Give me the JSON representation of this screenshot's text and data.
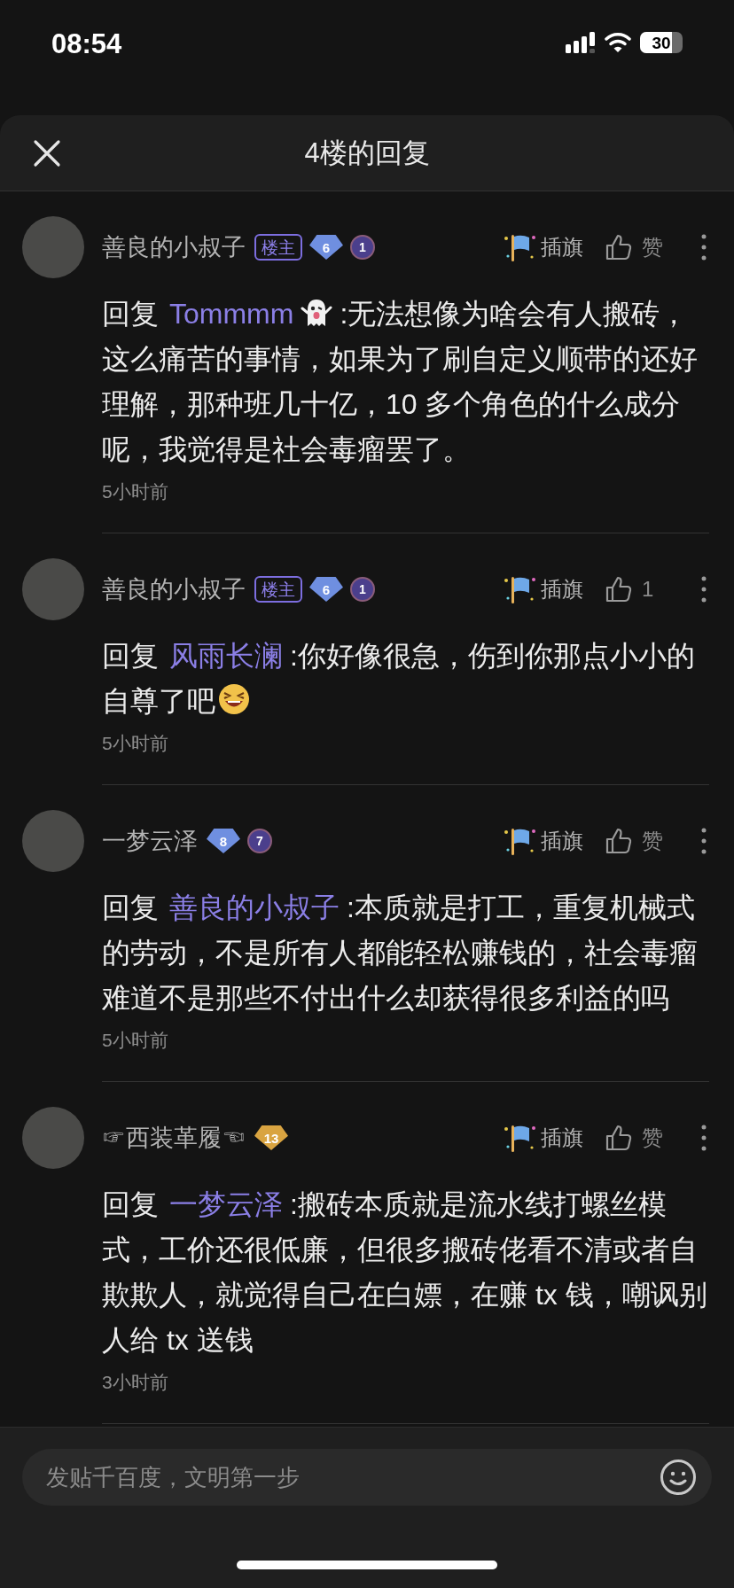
{
  "status_bar": {
    "time": "08:54",
    "battery": "30"
  },
  "sheet": {
    "title": "4楼的回复"
  },
  "comments": [
    {
      "author": "善良的小叔子",
      "badges": [
        {
          "kind": "host",
          "text": "楼主"
        },
        {
          "kind": "level",
          "text": "6",
          "color": "#6f8fe0"
        },
        {
          "kind": "medal",
          "text": "1"
        }
      ],
      "flag_label": "插旗",
      "like_label": "赞",
      "content": [
        {
          "kind": "prefix",
          "text": "回复"
        },
        {
          "kind": "mention",
          "text": "Tommmm"
        },
        {
          "kind": "ghost_emoji"
        },
        {
          "kind": "text",
          "text": ":无法想像为啥会有人搬砖，这么痛苦的事情，如果为了刷自定义顺带的还好理解，那种班几十亿，10 多个角色的什么成分呢，我觉得是社会毒瘤罢了。"
        }
      ],
      "time": "5小时前"
    },
    {
      "author": "善良的小叔子",
      "badges": [
        {
          "kind": "host",
          "text": "楼主"
        },
        {
          "kind": "level",
          "text": "6",
          "color": "#6f8fe0"
        },
        {
          "kind": "medal",
          "text": "1"
        }
      ],
      "flag_label": "插旗",
      "like_label": "1",
      "content": [
        {
          "kind": "prefix",
          "text": "回复"
        },
        {
          "kind": "mention",
          "text": "风雨长澜"
        },
        {
          "kind": "text",
          "text": ":你好像很急，伤到你那点小小的自尊了吧"
        },
        {
          "kind": "grin_emoji"
        }
      ],
      "time": "5小时前"
    },
    {
      "author": "一梦云泽",
      "badges": [
        {
          "kind": "level",
          "text": "8",
          "color": "#6f8fe0"
        },
        {
          "kind": "medal",
          "text": "7"
        }
      ],
      "flag_label": "插旗",
      "like_label": "赞",
      "content": [
        {
          "kind": "prefix",
          "text": "回复"
        },
        {
          "kind": "mention",
          "text": "善良的小叔子"
        },
        {
          "kind": "text",
          "text": ":本质就是打工，重复机械式的劳动，不是所有人都能轻松赚钱的，社会毒瘤难道不是那些不付出什么却获得很多利益的吗"
        }
      ],
      "time": "5小时前"
    },
    {
      "author": "☞西装革履☜",
      "badges": [
        {
          "kind": "level",
          "text": "13",
          "color": "#d9a441"
        }
      ],
      "flag_label": "插旗",
      "like_label": "赞",
      "content": [
        {
          "kind": "prefix",
          "text": "回复"
        },
        {
          "kind": "mention",
          "text": "一梦云泽"
        },
        {
          "kind": "text",
          "text": ":搬砖本质就是流水线打螺丝模式，工价还很低廉，但很多搬砖佬看不清或者自欺欺人，就觉得自己在白嫖，在赚 tx 钱，嘲讽别人给 tx 送钱"
        }
      ],
      "time": "3小时前"
    }
  ],
  "composer": {
    "placeholder": "发贴千百度，文明第一步"
  }
}
